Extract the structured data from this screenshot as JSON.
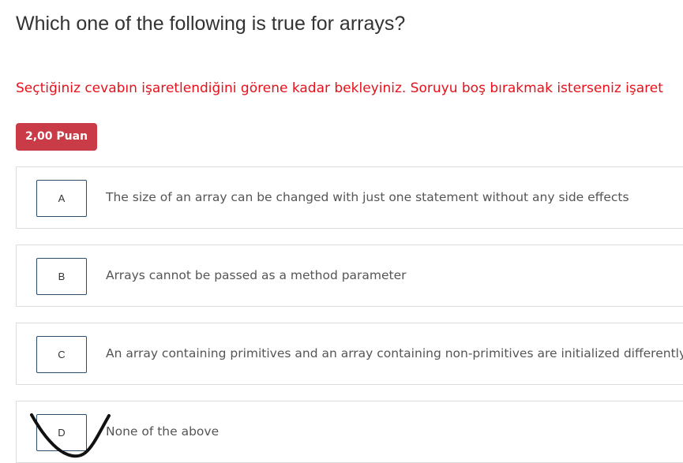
{
  "question": {
    "title": "Which one of the following is true for arrays?",
    "instruction": "Seçtiğiniz cevabın işaretlendiğini görene kadar bekleyiniz. Soruyu boş bırakmak isterseniz işaret",
    "points": "2,00 Puan"
  },
  "options": [
    {
      "letter": "A",
      "text": "The size of an array can be changed with just one statement without any side effects"
    },
    {
      "letter": "B",
      "text": "Arrays cannot be passed as a method parameter"
    },
    {
      "letter": "C",
      "text": "An array containing primitives and an array containing non-primitives are initialized differently"
    },
    {
      "letter": "D",
      "text": "None of the above"
    }
  ],
  "colors": {
    "instruction": "#e8101a",
    "badge": "#c93b47",
    "border": "#dcdcdc",
    "letter_border": "#2a4d6e",
    "mark": "#111111"
  },
  "marked_option": "D"
}
